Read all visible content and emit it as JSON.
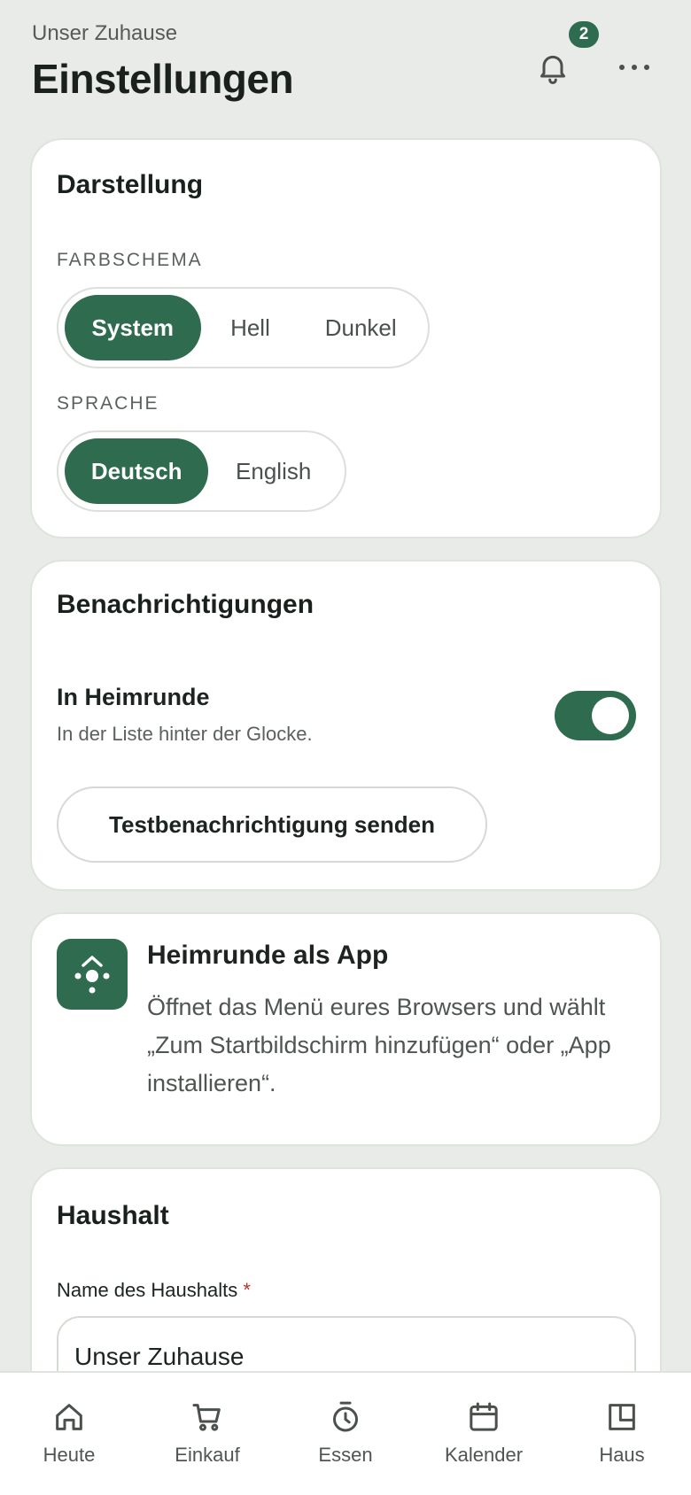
{
  "header": {
    "household": "Unser Zuhause",
    "title": "Einstellungen",
    "notification_count": "2",
    "bell_icon": "bell-icon",
    "more_icon": "more-horizontal-icon"
  },
  "appearance": {
    "title": "Darstellung",
    "color_scheme_label": "FARBSCHEMA",
    "color_scheme_options": [
      "System",
      "Hell",
      "Dunkel"
    ],
    "color_scheme_selected": "System",
    "language_label": "SPRACHE",
    "language_options": [
      "Deutsch",
      "English"
    ],
    "language_selected": "Deutsch"
  },
  "notifications": {
    "title": "Benachrichtigungen",
    "in_app_title": "In Heimrunde",
    "in_app_subtitle": "In der Liste hinter der Glocke.",
    "in_app_enabled": true,
    "test_button": "Testbenachrichtigung senden"
  },
  "install": {
    "title": "Heimrunde als App",
    "text": "Öffnet das Menü eures Browsers und wählt „Zum Startbildschirm hinzufügen“ oder „App installieren“.",
    "icon": "heimrunde-logo-icon"
  },
  "household": {
    "title": "Haushalt",
    "name_label": "Name des Haushalts",
    "required_marker": "*",
    "name_value": "Unser Zuhause"
  },
  "bottom_nav": [
    {
      "label": "Heute",
      "icon": "home-icon"
    },
    {
      "label": "Einkauf",
      "icon": "cart-icon"
    },
    {
      "label": "Essen",
      "icon": "timer-icon"
    },
    {
      "label": "Kalender",
      "icon": "calendar-icon"
    },
    {
      "label": "Haus",
      "icon": "layout-icon"
    }
  ],
  "colors": {
    "accent": "#2e6b4f",
    "background": "#e8ebe7",
    "required": "#b3362f"
  }
}
